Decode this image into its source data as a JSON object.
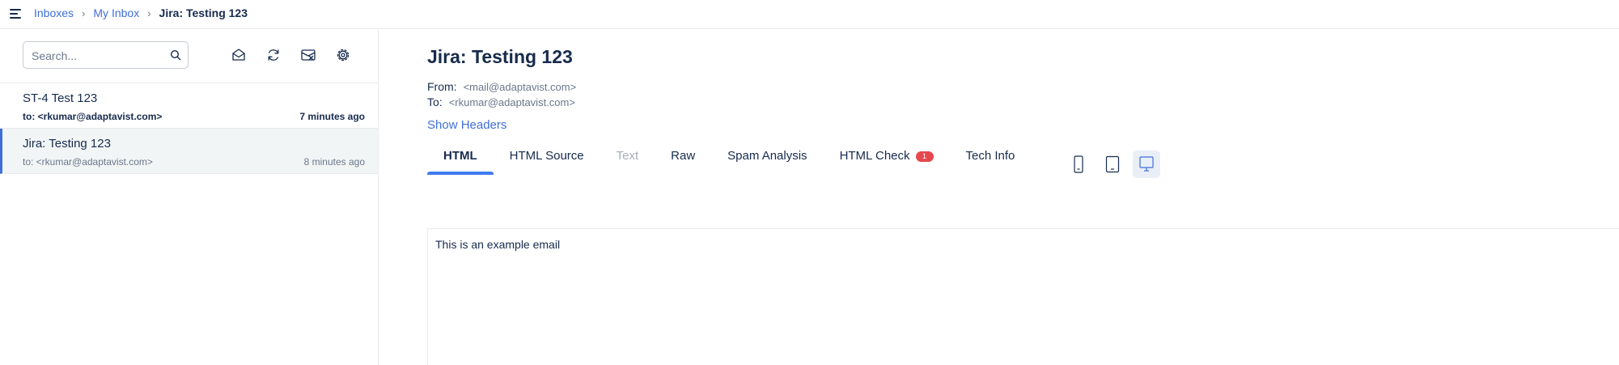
{
  "breadcrumb": {
    "items": [
      "Inboxes",
      "My Inbox"
    ],
    "current": "Jira: Testing 123"
  },
  "search": {
    "placeholder": "Search..."
  },
  "toolbar": {
    "icons": [
      "mail-open-icon",
      "refresh-icon",
      "clear-inbox-icon",
      "settings-gear-icon"
    ]
  },
  "emails": [
    {
      "subject": "ST-4 Test 123",
      "to": "to: <rkumar@adaptavist.com>",
      "time": "7 minutes ago",
      "unread": true
    },
    {
      "subject": "Jira: Testing 123",
      "to": "to: <rkumar@adaptavist.com>",
      "time": "8 minutes ago",
      "selected": true
    }
  ],
  "message": {
    "title": "Jira: Testing 123",
    "from_label": "From:",
    "from_value": "<mail@adaptavist.com>",
    "to_label": "To:",
    "to_value": "<rkumar@adaptavist.com>",
    "show_headers": "Show Headers",
    "body": "This is an example email"
  },
  "tabs": [
    {
      "label": "HTML",
      "active": true
    },
    {
      "label": "HTML Source"
    },
    {
      "label": "Text",
      "disabled": true
    },
    {
      "label": "Raw"
    },
    {
      "label": "Spam Analysis"
    },
    {
      "label": "HTML Check",
      "badge": "1"
    },
    {
      "label": "Tech Info"
    }
  ],
  "preview_devices": [
    {
      "icon": "mobile-icon"
    },
    {
      "icon": "tablet-icon"
    },
    {
      "icon": "desktop-icon",
      "selected": true
    }
  ],
  "colors": {
    "accent": "#3e6fd8",
    "tab_underline": "#3e7bf0",
    "badge": "#e5484d",
    "selected_row": "#f1f5f5",
    "text": "#172b4d",
    "muted": "#6b778c"
  }
}
